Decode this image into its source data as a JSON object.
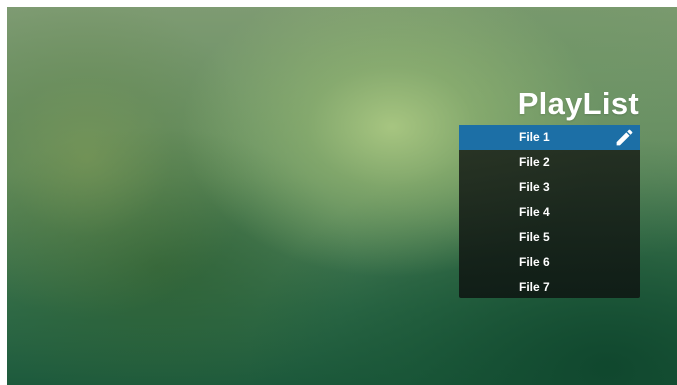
{
  "playlist": {
    "title": "PlayList",
    "selected_index": 0,
    "items": [
      {
        "label": "File 1"
      },
      {
        "label": "File 2"
      },
      {
        "label": "File 3"
      },
      {
        "label": "File 4"
      },
      {
        "label": "File 5"
      },
      {
        "label": "File 6"
      },
      {
        "label": "File 7"
      }
    ],
    "edit_icon": "pencil-icon"
  },
  "colors": {
    "selection": "#1c6fa6",
    "text": "#ffffff",
    "panel": "#1a2519"
  }
}
